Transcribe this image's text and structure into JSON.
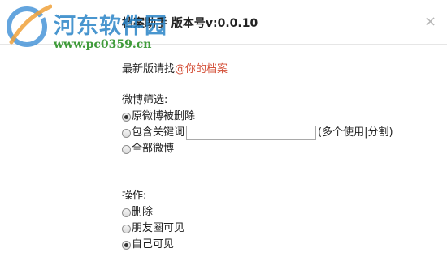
{
  "window": {
    "title": "档案助手 版本号v:0.0.10",
    "close_glyph": "×"
  },
  "watermark": {
    "brand": "河东软件园",
    "url": "www.pc0359.cn"
  },
  "notice": {
    "prefix": "最新版请找",
    "link": "@你的档案"
  },
  "filter": {
    "label": "微博筛选:",
    "options": [
      {
        "label": "原微博被删除",
        "checked": true
      },
      {
        "label": "包含关键词",
        "checked": false
      },
      {
        "label": "全部微博",
        "checked": false
      }
    ],
    "keyword_value": "",
    "keyword_hint": "(多个使用|分割)"
  },
  "action": {
    "label": "操作:",
    "options": [
      {
        "label": "删除",
        "checked": false
      },
      {
        "label": "朋友圈可见",
        "checked": false
      },
      {
        "label": "自己可见",
        "checked": true
      }
    ]
  },
  "colors": {
    "link": "#d4513a",
    "brand": "#2a84c7",
    "url": "#3f9b3a"
  }
}
